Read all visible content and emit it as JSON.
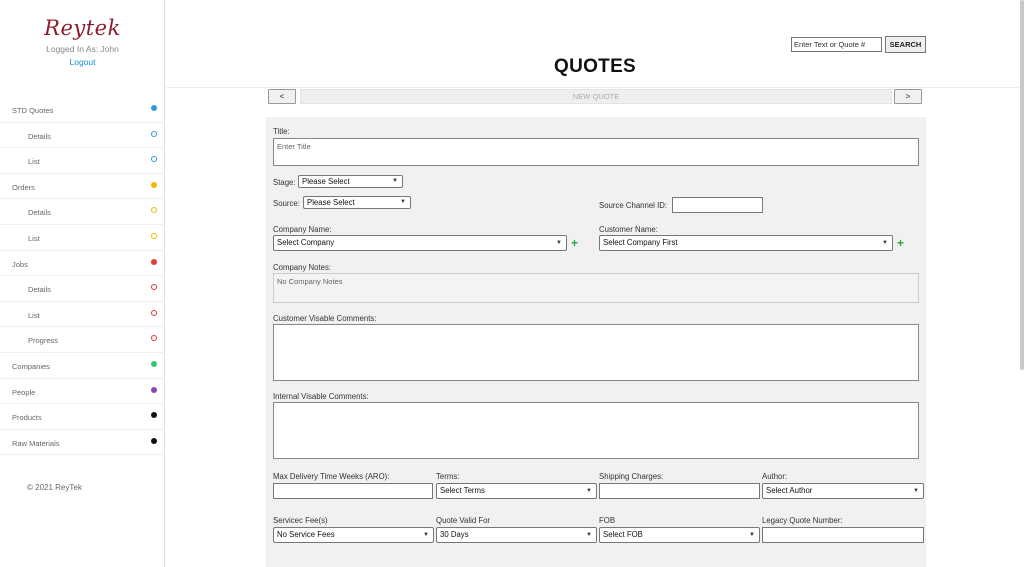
{
  "sidebar": {
    "logo": "Reytek",
    "logged_in": "Logged In As: John",
    "logout": "Logout",
    "items": [
      {
        "label": "STD Quotes",
        "sub": false,
        "color": "#3498db",
        "hollow": false
      },
      {
        "label": "Details",
        "sub": true,
        "color": "#3498db",
        "hollow": true
      },
      {
        "label": "List",
        "sub": true,
        "color": "#3498db",
        "hollow": true
      },
      {
        "label": "Orders",
        "sub": false,
        "color": "#f1b800",
        "hollow": false
      },
      {
        "label": "Details",
        "sub": true,
        "color": "#f1b800",
        "hollow": true
      },
      {
        "label": "List",
        "sub": true,
        "color": "#f1b800",
        "hollow": true
      },
      {
        "label": "Jobs",
        "sub": false,
        "color": "#e53935",
        "hollow": false
      },
      {
        "label": "Details",
        "sub": true,
        "color": "#e53935",
        "hollow": true
      },
      {
        "label": "List",
        "sub": true,
        "color": "#e53935",
        "hollow": true
      },
      {
        "label": "Progress",
        "sub": true,
        "color": "#e53935",
        "hollow": true
      },
      {
        "label": "Companies",
        "sub": false,
        "color": "#2ecc71",
        "hollow": false
      },
      {
        "label": "People",
        "sub": false,
        "color": "#8e44ad",
        "hollow": false
      },
      {
        "label": "Products",
        "sub": false,
        "color": "#111111",
        "hollow": false
      },
      {
        "label": "Raw Materials",
        "sub": false,
        "color": "#111111",
        "hollow": false
      }
    ],
    "copyright": "© 2021 ReyTek"
  },
  "header": {
    "search_placeholder": "Enter Text or Quote #",
    "search_button": "SEARCH",
    "title": "QUOTES"
  },
  "pager": {
    "prev": "<",
    "label": "NEW QUOTE",
    "next": ">"
  },
  "form": {
    "title_label": "Title:",
    "title_placeholder": "Enter Title",
    "stage_label": "Stage:",
    "stage_value": "Please Select",
    "source_label": "Source:",
    "source_value": "Please Select",
    "source_channel_label": "Source Channel ID:",
    "company_name_label": "Company Name:",
    "company_value": "Select Company",
    "customer_name_label": "Customer Name:",
    "customer_value": "Select Company First",
    "company_notes_label": "Company Notes:",
    "company_notes_placeholder": "No Company Notes",
    "customer_comments_label": "Customer Visable Comments:",
    "internal_comments_label": "Internal Visable Comments:",
    "max_delivery_label": "Max Delivery Time Weeks (ARO):",
    "terms_label": "Terms:",
    "terms_value": "Select Terms",
    "shipping_label": "Shipping Charges:",
    "author_label": "Author:",
    "author_value": "Select Author",
    "service_fee_label": "Servicec Fee(s)",
    "service_fee_value": "No Service Fees",
    "quote_valid_label": "Quote Valid For",
    "quote_valid_value": "30 Days",
    "fob_label": "FOB",
    "fob_value": "Select FOB",
    "legacy_label": "Legacy Quote Number:"
  }
}
